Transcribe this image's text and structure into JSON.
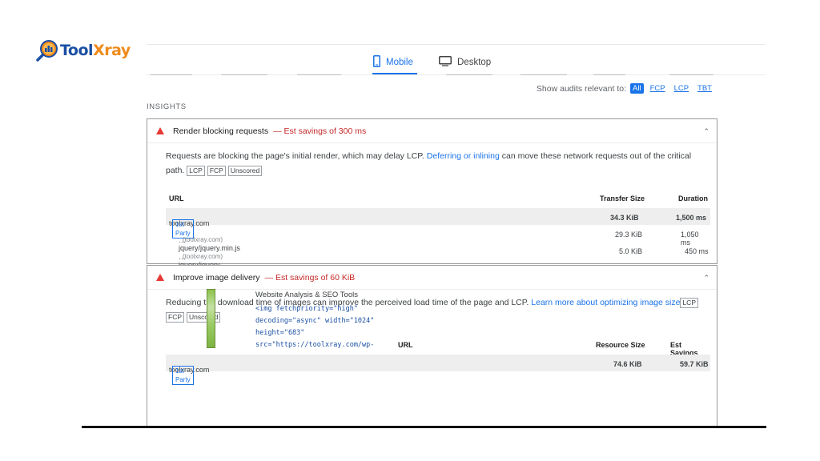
{
  "brand": {
    "part1": "Tool",
    "part2": "Xray"
  },
  "tabs": {
    "mobile": "Mobile",
    "desktop": "Desktop"
  },
  "filter": {
    "label": "Show audits relevant to:",
    "options": [
      "All",
      "FCP",
      "LCP",
      "TBT"
    ],
    "active": "All"
  },
  "insights": {
    "label": "INSIGHTS",
    "render_blocking": {
      "title": "Render blocking requests",
      "savings": "— Est savings of 300 ms",
      "desc_before": "Requests are blocking the page's initial render, which may delay LCP.",
      "desc_link": "Deferring or inlining",
      "desc_after": "can move these network requests out of the critical path.",
      "tags": [
        "LCP",
        "FCP",
        "Unscored"
      ],
      "headers": {
        "url": "URL",
        "size": "Transfer Size",
        "duration": "Duration"
      },
      "rows": [
        {
          "url": "toolxray.com",
          "party": "1st Party",
          "size": "34.3 KiB",
          "duration": "1,500 ms"
        },
        {
          "url": "…jquery/jquery.min.js",
          "host": "(toolxray.com)",
          "size": "29.3 KiB",
          "duration": "1,050 ms"
        },
        {
          "url": "…jquery/jquery-migrate.min.js",
          "host": "(toolxray.com)",
          "size": "5.0 KiB",
          "duration": "450 ms"
        }
      ]
    },
    "image_delivery": {
      "title": "Improve image delivery",
      "savings": "— Est savings of 60 KiB",
      "desc_before": "Reducing the download time of images can improve the perceived load time of the page and LCP.",
      "desc_link": "Learn more about optimizing image size",
      "tags": [
        "LCP",
        "FCP",
        "Unscored"
      ],
      "headers": {
        "url": "URL",
        "size": "Resource Size",
        "savings": "Est Savings"
      },
      "row": {
        "url": "toolxray.com",
        "party": "1st Party",
        "size": "74.6 KiB",
        "savings": "59.7 KiB"
      },
      "element_title": "Website Analysis & SEO Tools",
      "code": [
        "<img fetchpriority=\"high\"",
        "decoding=\"async\" width=\"1024\"",
        "height=\"683\"",
        "src=\"https://toolxray.com/wp-"
      ]
    }
  }
}
